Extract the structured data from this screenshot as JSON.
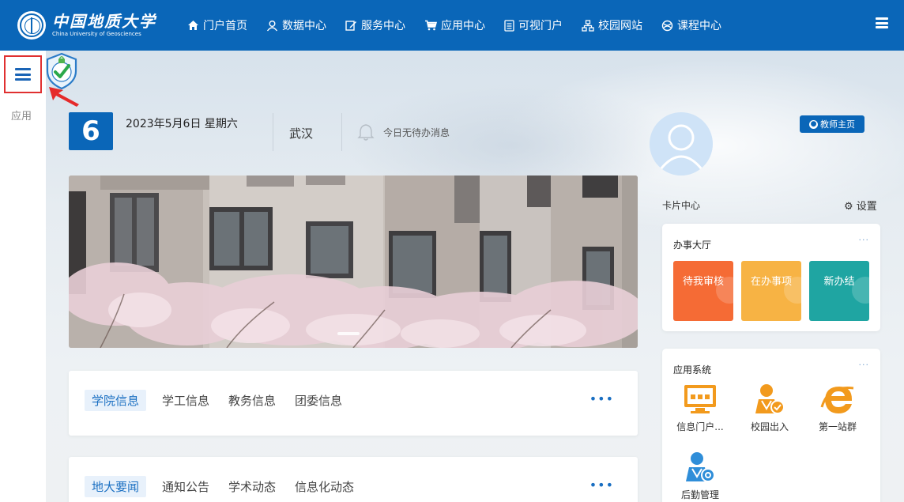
{
  "brand": {
    "name_cn": "中国地质大学",
    "name_en": "China University of Geosciences"
  },
  "nav": {
    "items": [
      {
        "label": "门户首页",
        "icon": "home-icon"
      },
      {
        "label": "数据中心",
        "icon": "user-icon"
      },
      {
        "label": "服务中心",
        "icon": "edit-icon"
      },
      {
        "label": "应用中心",
        "icon": "cart-icon"
      },
      {
        "label": "可视门户",
        "icon": "doc-icon"
      },
      {
        "label": "校园网站",
        "icon": "sitemap-icon"
      },
      {
        "label": "课程中心",
        "icon": "globe-icon"
      }
    ]
  },
  "sidebar": {
    "label": "应用"
  },
  "info": {
    "day": "6",
    "date": "2023年5月6日 星期六",
    "city": "武汉",
    "notice": "今日无待办消息"
  },
  "panel1": {
    "tabs": [
      "学院信息",
      "学工信息",
      "教务信息",
      "团委信息"
    ],
    "more": "•••"
  },
  "panel2": {
    "tabs": [
      "地大要闻",
      "通知公告",
      "学术动态",
      "信息化动态"
    ],
    "more": "•••"
  },
  "profile": {
    "teacher_button": "教师主页"
  },
  "cards": {
    "center_label": "卡片中心",
    "settings_label": "设置",
    "hall": {
      "title": "办事大厅",
      "more": "···",
      "tiles": [
        "待我审核",
        "在办事项",
        "新办结"
      ]
    },
    "apps": {
      "title": "应用系统",
      "more": "···",
      "items": [
        "信息门户...",
        "校园出入",
        "第一站群",
        "后勤管理"
      ]
    }
  },
  "colors": {
    "brand_blue": "#0a66b8",
    "tile_orange": "#f56b35",
    "tile_yellow": "#f7b344",
    "tile_teal": "#1fa5a2"
  }
}
